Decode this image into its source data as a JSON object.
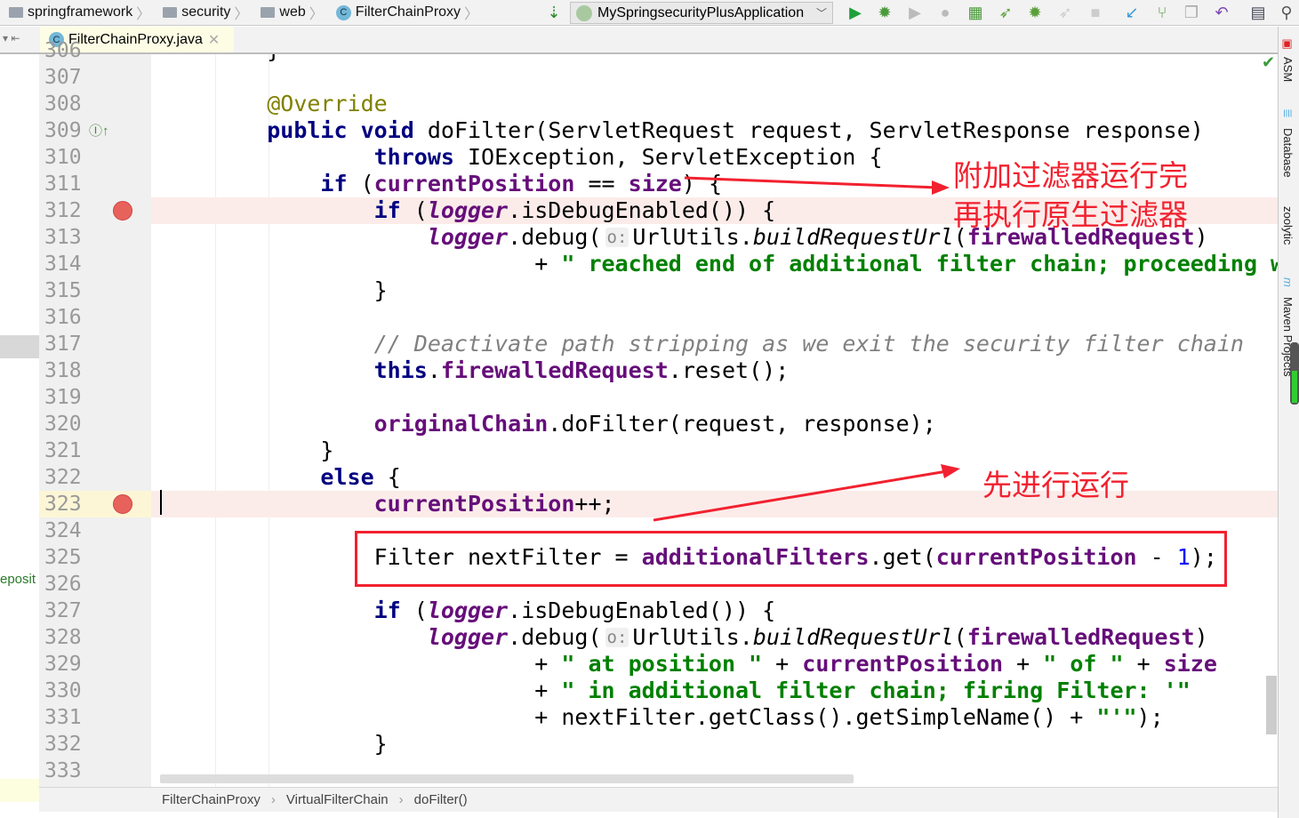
{
  "breadcrumbs": [
    "springframework",
    "security",
    "web",
    "FilterChainProxy"
  ],
  "run_config": "MySpringsecurityPlusApplication",
  "toolbar_icons": [
    "sort-icon",
    "run-icon",
    "debug-icon",
    "run-disabled-icon",
    "attach-icon",
    "coverage-icon",
    "run-jrebel-icon",
    "debug-jrebel-icon",
    "deploy-icon",
    "stop-icon",
    "vcs-update-icon",
    "vcs-branch-icon",
    "vcs-compare-icon",
    "undo-icon",
    "structure-icon",
    "search-icon"
  ],
  "tab": {
    "title": "FilterChainProxy.java",
    "icon": "C"
  },
  "left_panel_text": "eposit",
  "right_tools": [
    "ASM",
    "Database",
    "zoolytic",
    "Maven Projects"
  ],
  "code": [
    {
      "num": "306",
      "segs": [
        [
          "p",
          "    }"
        ]
      ]
    },
    {
      "num": "307",
      "segs": []
    },
    {
      "num": "308",
      "segs": [
        [
          "p",
          "    "
        ],
        [
          "a",
          "@Override"
        ]
      ]
    },
    {
      "num": "309",
      "segs": [
        [
          "p",
          "    "
        ],
        [
          "k",
          "public"
        ],
        [
          "p",
          " "
        ],
        [
          "k",
          "void"
        ],
        [
          "p",
          " doFilter(ServletRequest request, ServletResponse response)"
        ]
      ]
    },
    {
      "num": "310",
      "segs": [
        [
          "p",
          "            "
        ],
        [
          "k",
          "throws"
        ],
        [
          "p",
          " IOException, ServletException {"
        ]
      ]
    },
    {
      "num": "311",
      "segs": [
        [
          "p",
          "        "
        ],
        [
          "k",
          "if"
        ],
        [
          "p",
          " ("
        ],
        [
          "f",
          "currentPosition"
        ],
        [
          "p",
          " == "
        ],
        [
          "f",
          "size"
        ],
        [
          "p",
          ") {"
        ]
      ]
    },
    {
      "num": "312",
      "bp": true,
      "segs": [
        [
          "p",
          "            "
        ],
        [
          "k",
          "if"
        ],
        [
          "p",
          " ("
        ],
        [
          "fi",
          "logger"
        ],
        [
          "p",
          ".isDebugEnabled()) {"
        ]
      ]
    },
    {
      "num": "313",
      "segs": [
        [
          "p",
          "                "
        ],
        [
          "fi",
          "logger"
        ],
        [
          "p",
          ".debug("
        ],
        [
          "h",
          "o:"
        ],
        [
          "p",
          "UrlUtils."
        ],
        [
          "i",
          "buildRequestUrl"
        ],
        [
          "p",
          "("
        ],
        [
          "f",
          "firewalledRequest"
        ],
        [
          "p",
          ")"
        ]
      ]
    },
    {
      "num": "314",
      "segs": [
        [
          "p",
          "                        + "
        ],
        [
          "s",
          "\" reached end of additional filter chain; proceeding w"
        ]
      ]
    },
    {
      "num": "315",
      "segs": [
        [
          "p",
          "            }"
        ]
      ]
    },
    {
      "num": "316",
      "segs": []
    },
    {
      "num": "317",
      "segs": [
        [
          "p",
          "            "
        ],
        [
          "c",
          "// Deactivate path stripping as we exit the security filter chain"
        ]
      ]
    },
    {
      "num": "318",
      "segs": [
        [
          "p",
          "            "
        ],
        [
          "k",
          "this"
        ],
        [
          "p",
          "."
        ],
        [
          "f",
          "firewalledRequest"
        ],
        [
          "p",
          ".reset();"
        ]
      ]
    },
    {
      "num": "319",
      "segs": []
    },
    {
      "num": "320",
      "segs": [
        [
          "p",
          "            "
        ],
        [
          "f",
          "originalChain"
        ],
        [
          "p",
          ".doFilter(request, response);"
        ]
      ]
    },
    {
      "num": "321",
      "segs": [
        [
          "p",
          "        }"
        ]
      ]
    },
    {
      "num": "322",
      "segs": [
        [
          "p",
          "        "
        ],
        [
          "k",
          "else"
        ],
        [
          "p",
          " {"
        ]
      ]
    },
    {
      "num": "323",
      "bp": true,
      "segs": [
        [
          "p",
          "            "
        ],
        [
          "f",
          "currentPosition"
        ],
        [
          "p",
          "++;"
        ]
      ]
    },
    {
      "num": "324",
      "segs": []
    },
    {
      "num": "325",
      "segs": [
        [
          "p",
          "            Filter nextFilter = "
        ],
        [
          "f",
          "additionalFilters"
        ],
        [
          "p",
          ".get("
        ],
        [
          "f",
          "currentPosition"
        ],
        [
          "p",
          " - "
        ],
        [
          "n",
          "1"
        ],
        [
          "p",
          ");"
        ]
      ]
    },
    {
      "num": "326",
      "segs": []
    },
    {
      "num": "327",
      "segs": [
        [
          "p",
          "            "
        ],
        [
          "k",
          "if"
        ],
        [
          "p",
          " ("
        ],
        [
          "fi",
          "logger"
        ],
        [
          "p",
          ".isDebugEnabled()) {"
        ]
      ]
    },
    {
      "num": "328",
      "segs": [
        [
          "p",
          "                "
        ],
        [
          "fi",
          "logger"
        ],
        [
          "p",
          ".debug("
        ],
        [
          "h",
          "o:"
        ],
        [
          "p",
          "UrlUtils."
        ],
        [
          "i",
          "buildRequestUrl"
        ],
        [
          "p",
          "("
        ],
        [
          "f",
          "firewalledRequest"
        ],
        [
          "p",
          ")"
        ]
      ]
    },
    {
      "num": "329",
      "segs": [
        [
          "p",
          "                        + "
        ],
        [
          "s",
          "\" at position \""
        ],
        [
          "p",
          " + "
        ],
        [
          "f",
          "currentPosition"
        ],
        [
          "p",
          " + "
        ],
        [
          "s",
          "\" of \""
        ],
        [
          "p",
          " + "
        ],
        [
          "f",
          "size"
        ]
      ]
    },
    {
      "num": "330",
      "segs": [
        [
          "p",
          "                        + "
        ],
        [
          "s",
          "\" in additional filter chain; firing Filter: '\""
        ]
      ]
    },
    {
      "num": "331",
      "segs": [
        [
          "p",
          "                        + nextFilter.getClass().getSimpleName() + "
        ],
        [
          "s",
          "\"'\""
        ],
        [
          "p",
          ");"
        ]
      ]
    },
    {
      "num": "332",
      "segs": [
        [
          "p",
          "            }"
        ]
      ]
    },
    {
      "num": "333",
      "segs": []
    }
  ],
  "annotations": {
    "top_line1": "附加过滤器运行完",
    "top_line2": "再执行原生过滤器",
    "bottom": "先进行运行"
  },
  "status_breadcrumbs": [
    "FilterChainProxy",
    "VirtualFilterChain",
    "doFilter()"
  ],
  "colors": {
    "keyword": "#000080",
    "field": "#660e7a",
    "string": "#008000",
    "annotation_red": "#f2212f",
    "breakpoint": "#e8625c",
    "highlight": "#fbecea"
  }
}
